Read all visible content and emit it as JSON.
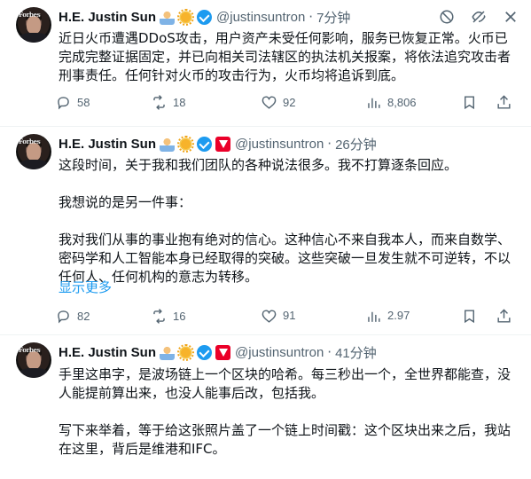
{
  "tweets": [
    {
      "name": "H.E. Justin Sun",
      "avatar_text": "Forbes",
      "badges": [
        "person-emoji",
        "sun-emoji",
        "verified-badge"
      ],
      "handle": "@justinsuntron",
      "separator": "·",
      "time": "7分钟",
      "text": "近日火币遭遇DDoS攻击，用户资产未受任何影响，服务已恢复正常。火币已\n完成完整证据固定，并已向相关司法辖区的执法机关报案，将依法追究攻击者\n刑事责任。任何针对火币的攻击行为，火币均将追诉到底。",
      "replies": "58",
      "retweets": "18",
      "likes": "92",
      "views": "8,806"
    },
    {
      "name": "H.E. Justin Sun",
      "avatar_text": "Forbes",
      "badges": [
        "person-emoji",
        "sun-emoji",
        "verified-badge",
        "tron-badge"
      ],
      "handle": "@justinsuntron",
      "separator": "·",
      "time": "26分钟",
      "text": "这段时间，关于我和我们团队的各种说法很多。我不打算逐条回应。\n\n我想说的是另一件事：\n\n我对我们从事的事业抱有绝对的信心。这种信心不来自我本人，而来自数学、\n密码学和人工智能本身已经取得的突破。这些突破一旦发生就不可逆转，不以\n任何人、任何机构的意志为转移。",
      "show_more": "显示更多",
      "replies": "82",
      "retweets": "16",
      "likes": "91",
      "views": "2.97"
    },
    {
      "name": "H.E. Justin Sun",
      "avatar_text": "Forbes",
      "badges": [
        "person-emoji",
        "sun-emoji",
        "verified-badge",
        "tron-badge"
      ],
      "handle": "@justinsuntron",
      "separator": "·",
      "time": "41分钟",
      "text": "手里这串字，是波场链上一个区块的哈希。每三秒出一个，全世界都能查，没\n人能提前算出来，也没人能事后改，包括我。\n\n写下来举着，等于给这张照片盖了一个链上时间戳：这个区块出来之后，我站\n在这里，背后是维港和IFC。"
    }
  ],
  "icons": {
    "top": [
      "mute-icon",
      "hide-icon",
      "more-icon"
    ],
    "actions": [
      "reply-icon",
      "retweet-icon",
      "like-icon",
      "views-icon",
      "bookmark-icon",
      "share-icon"
    ]
  },
  "colors": {
    "accent": "#1d9bf0",
    "muted": "#536471",
    "text": "#0f1419",
    "divider": "#eff3f4"
  }
}
